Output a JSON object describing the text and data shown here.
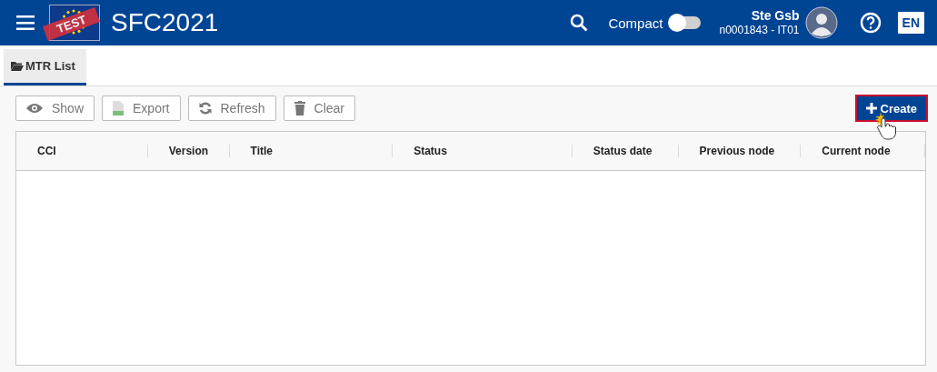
{
  "header": {
    "badge": "TEST",
    "app_title": "SFC2021",
    "compact_label": "Compact",
    "compact_on": false,
    "user_name": "Ste Gsb",
    "user_id": "n0001843 - IT01",
    "language": "EN"
  },
  "tabs": [
    {
      "label": "MTR List",
      "selected": true
    }
  ],
  "toolbar": [
    {
      "kind": "show",
      "label": "Show",
      "disabled": true
    },
    {
      "kind": "export",
      "label": "Export",
      "disabled": true
    },
    {
      "kind": "refresh",
      "label": "Refresh",
      "disabled": true
    },
    {
      "kind": "clear",
      "label": "Clear",
      "disabled": true
    }
  ],
  "create_button": {
    "label": "Create"
  },
  "table": {
    "columns": [
      "CCI",
      "Version",
      "Title",
      "Status",
      "Status date",
      "Previous node",
      "Current node"
    ]
  }
}
